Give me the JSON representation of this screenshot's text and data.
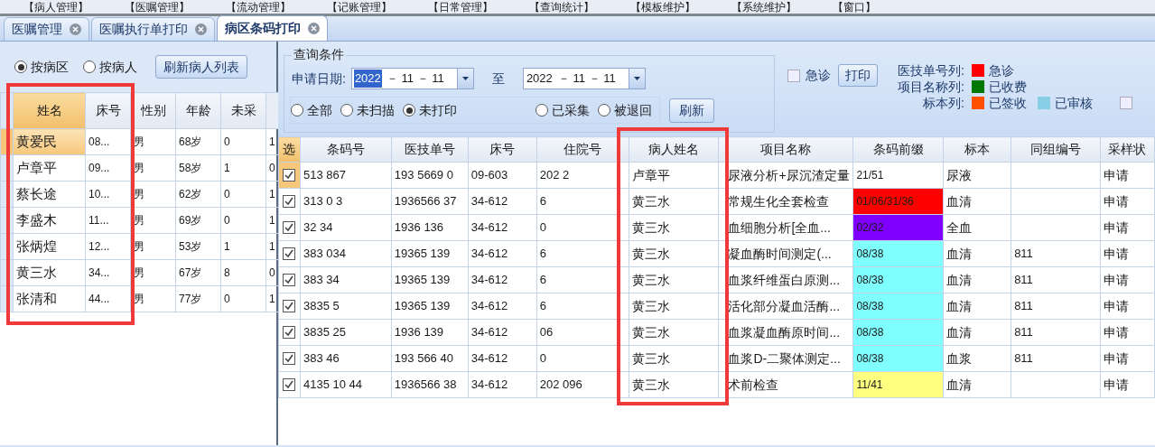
{
  "menu": [
    "【病人管理】",
    "【医嘱管理】",
    "【流动管理】",
    "【记账管理】",
    "【日常管理】",
    "【查询统计】",
    "【模板维护】",
    "【系统维护】",
    "【窗口】"
  ],
  "tabs": [
    {
      "label": "医嘱管理",
      "selected": false
    },
    {
      "label": "医嘱执行单打印",
      "selected": false
    },
    {
      "label": "病区条码打印",
      "selected": true
    }
  ],
  "patient_panel": {
    "filter_options": [
      {
        "label": "按病区",
        "selected": true
      },
      {
        "label": "按病人",
        "selected": false
      }
    ],
    "refresh_button": "刷新病人列表",
    "columns": [
      "姓名",
      "床号",
      "性别",
      "年龄",
      "未采"
    ],
    "rows": [
      {
        "selected": true,
        "cells": [
          "黄爱民",
          "08...",
          "男",
          "68岁",
          "0",
          "1"
        ]
      },
      {
        "selected": false,
        "cells": [
          "卢章平",
          "09...",
          "男",
          "58岁",
          "1",
          "0"
        ]
      },
      {
        "selected": false,
        "cells": [
          "蔡长途",
          "10...",
          "男",
          "62岁",
          "0",
          "1"
        ]
      },
      {
        "selected": false,
        "cells": [
          "李盛木",
          "11...",
          "男",
          "69岁",
          "0",
          "1"
        ]
      },
      {
        "selected": false,
        "cells": [
          "张炳煌",
          "12...",
          "男",
          "53岁",
          "1",
          "1"
        ]
      },
      {
        "selected": false,
        "cells": [
          "黄三水",
          "34...",
          "男",
          "67岁",
          "8",
          "0"
        ]
      },
      {
        "selected": false,
        "cells": [
          "张清和",
          "44...",
          "男",
          "77岁",
          "0",
          "1"
        ]
      }
    ]
  },
  "query": {
    "title": "查询条件",
    "date_label": "申请日期:",
    "date_from": {
      "year": "2022",
      "rest": "－ 11 － 11",
      "year_selected": true
    },
    "to_label": "至",
    "date_to": {
      "year": "2022",
      "rest": "－ 11 － 11",
      "year_selected": false
    },
    "status_options": [
      {
        "label": "全部",
        "selected": false
      },
      {
        "label": "未扫描",
        "selected": false
      },
      {
        "label": "未打印",
        "selected": true
      },
      {
        "label": "已采集",
        "selected": false
      },
      {
        "label": "被退回",
        "selected": false
      }
    ],
    "refresh_button": "刷新"
  },
  "urgent": {
    "label": "急诊",
    "checked": false
  },
  "print_button": "打印",
  "legend": [
    {
      "label": "医技单号列:",
      "items": [
        {
          "label": "急诊",
          "color": "#ff0000"
        }
      ]
    },
    {
      "label": "项目名称列:",
      "items": [
        {
          "label": "已收费",
          "color": "#007800"
        }
      ]
    },
    {
      "label": "标本列:",
      "items": [
        {
          "label": "已签收",
          "color": "#ff5000"
        },
        {
          "label": "已审核",
          "color": "#87cee6"
        }
      ]
    }
  ],
  "extra_checkbox": {
    "checked": false
  },
  "orders": {
    "select_header": "选",
    "columns": [
      "条码号",
      "医技单号",
      "床号",
      "住院号",
      "病人姓名",
      "项目名称",
      "条码前缀",
      "标本",
      "同组编号",
      "采样状"
    ],
    "rows": [
      {
        "selected": true,
        "checked": true,
        "color": "#ffffff",
        "cells": [
          "513 867",
          "193 5669 0",
          "09-603",
          "202 2",
          "卢章平",
          "尿液分析+尿沉渣定量",
          "21/51",
          "尿液",
          "",
          "申请"
        ]
      },
      {
        "selected": false,
        "checked": true,
        "color": "#ff0000",
        "cells": [
          "313 0 3",
          "1936566 37",
          "34-612",
          "6",
          "黄三水",
          "常规生化全套检查",
          "01/06/31/36",
          "血清",
          "",
          "申请"
        ]
      },
      {
        "selected": false,
        "checked": true,
        "color": "#8000ff",
        "cells": [
          "32 34",
          "1936 136",
          "34-612",
          "0",
          "黄三水",
          "血细胞分析[全血...",
          "02/32",
          "全血",
          "",
          "申请"
        ]
      },
      {
        "selected": false,
        "checked": true,
        "color": "#80ffff",
        "cells": [
          "383 034",
          "19365 139",
          "34-612",
          "6",
          "黄三水",
          "凝血酶时间测定(...",
          "08/38",
          "血清",
          "811",
          "申请"
        ]
      },
      {
        "selected": false,
        "checked": true,
        "color": "#80ffff",
        "cells": [
          "383 34",
          "19365 139",
          "34-612",
          "6",
          "黄三水",
          "血浆纤维蛋白原测...",
          "08/38",
          "血清",
          "811",
          "申请"
        ]
      },
      {
        "selected": false,
        "checked": true,
        "color": "#80ffff",
        "cells": [
          "3835 5",
          "19365 139",
          "34-612",
          "6",
          "黄三水",
          "活化部分凝血活酶...",
          "08/38",
          "血清",
          "811",
          "申请"
        ]
      },
      {
        "selected": false,
        "checked": true,
        "color": "#80ffff",
        "cells": [
          "3835 25",
          "1936 139",
          "34-612",
          "06",
          "黄三水",
          "血浆凝血酶原时间...",
          "08/38",
          "血清",
          "811",
          "申请"
        ]
      },
      {
        "selected": false,
        "checked": true,
        "color": "#80ffff",
        "cells": [
          "383 46",
          "193 566 40",
          "34-612",
          "0",
          "黄三水",
          "血浆D-二聚体测定...",
          "08/38",
          "血浆",
          "811",
          "申请"
        ]
      },
      {
        "selected": false,
        "checked": true,
        "color": "#ffff80",
        "cells": [
          "4135 10 44",
          "1936566 38",
          "34-612",
          "202 096",
          "黄三水",
          "术前检查",
          "11/41",
          "血清",
          "",
          "申请"
        ]
      }
    ]
  }
}
